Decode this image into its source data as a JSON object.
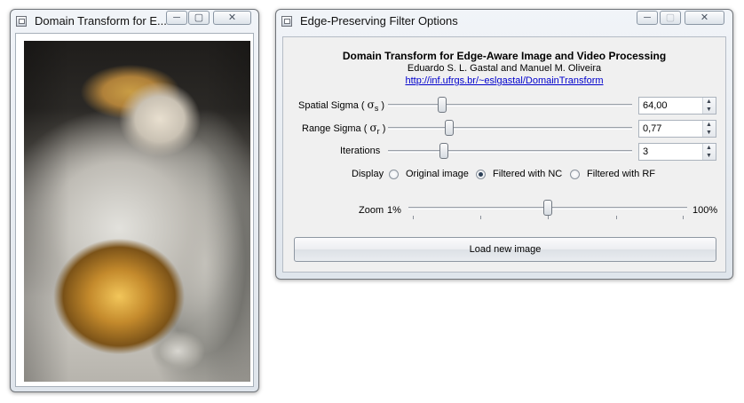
{
  "left_window": {
    "title": "Domain Transform for E...",
    "controls": {
      "minimize": "─",
      "maximize": "▢",
      "close": "✕"
    },
    "image_icon": "statue-photo"
  },
  "right_window": {
    "title": "Edge-Preserving Filter Options",
    "controls": {
      "minimize": "─",
      "maximize": "▢",
      "close": "✕"
    },
    "header": {
      "title": "Domain Transform for Edge-Aware Image and Video Processing",
      "authors": "Eduardo S. L. Gastal and Manuel M. Oliveira",
      "url": "http://inf.ufrgs.br/~eslgastal/DomainTransform"
    },
    "sliders": [
      {
        "label_prefix": "Spatial Sigma ( ",
        "symbol": "σ",
        "subscript": "s",
        "label_suffix": " )",
        "value": "64,00",
        "position": 0.22
      },
      {
        "label_prefix": "Range Sigma ( ",
        "symbol": "σ",
        "subscript": "r",
        "label_suffix": " )",
        "value": "0,77",
        "position": 0.25
      },
      {
        "label": "Iterations",
        "value": "3",
        "position": 0.23
      }
    ],
    "display": {
      "label": "Display",
      "options": [
        "Original image",
        "Filtered with NC",
        "Filtered with RF"
      ],
      "selected": "Filtered with NC"
    },
    "zoom": {
      "label": "Zoom",
      "min_label": "1%",
      "max_label": "100%",
      "position": 0.5
    },
    "load_button": "Load new image",
    "spin_icons": {
      "up": "▲",
      "down": "▼"
    }
  }
}
